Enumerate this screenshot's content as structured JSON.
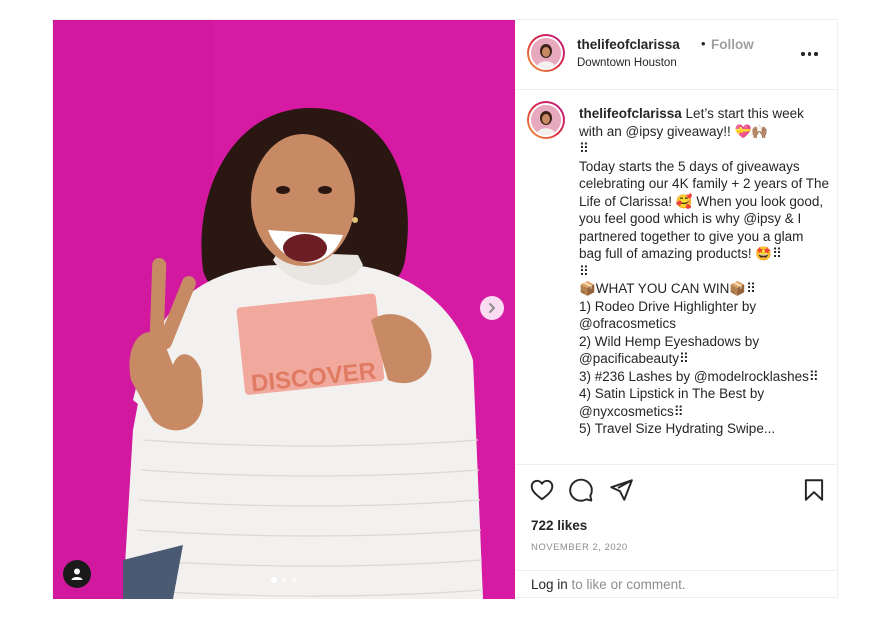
{
  "post": {
    "username": "thelifeofclarissa",
    "separator": "•",
    "follow_label": "Follow",
    "location": "Downtown Houston",
    "photo_overlay_text": "DISCOVER",
    "caption": {
      "username": "thelifeofclarissa",
      "text": " Let’s start this week with an @ipsy giveaway!! 💝🙌🏽\n⠿\nToday starts the 5 days of giveaways celebrating our 4K family + 2 years of The Life of Clarissa! 🥰 When you look good, you feel good which is why @ipsy & I partnered together to give you a glam bag full of amazing products! 🤩⠿\n⠿\n📦WHAT YOU CAN WIN📦⠿\n1) Rodeo Drive Highlighter by @ofracosmetics\n2) Wild Hemp Eyeshadows by @pacificabeauty⠿\n3) #236 Lashes by @modelrocklashes⠿\n4) Satin Lipstick in The Best by @nyxcosmetics⠿\n5) Travel Size Hydrating Swipe..."
    },
    "likes": "722 likes",
    "date": "NOVEMBER 2, 2020",
    "login_link": "Log in",
    "login_rest": " to like or comment."
  },
  "icons": {
    "like": "heart-icon",
    "comment": "comment-icon",
    "share": "paper-plane-icon",
    "save": "bookmark-icon",
    "more": "more-options-icon",
    "next": "chevron-right-icon",
    "tags": "user-tag-icon"
  },
  "carousel": {
    "count": 3,
    "active": 1
  },
  "colors": {
    "photo_background": "#d61aa3",
    "text": "#262626",
    "muted": "#8e8e8e",
    "follow": "#a0a0a0"
  }
}
